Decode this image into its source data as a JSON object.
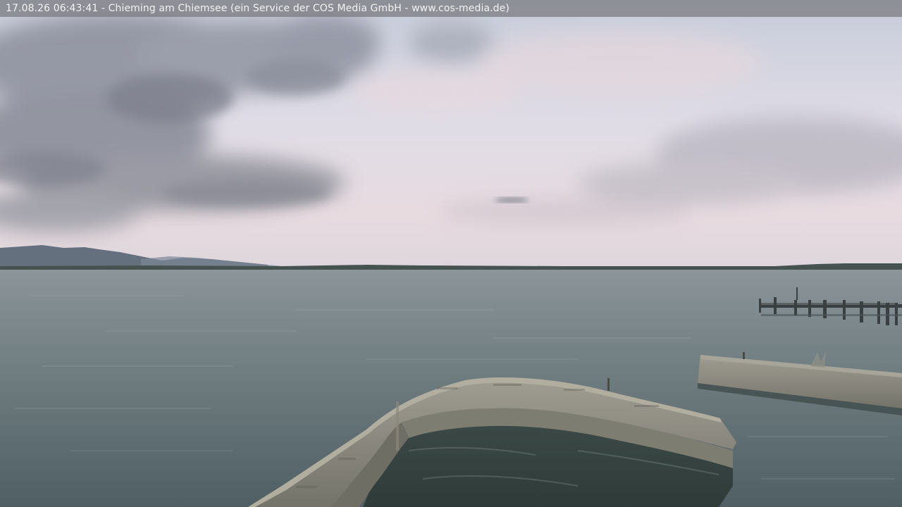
{
  "overlay": {
    "caption": "17.08.26 06:43:41 - Chieming am Chiemsee (ein Service der COS Media GmbH - www.cos-media.de)"
  },
  "scene": {
    "subject": "lake-chiemsee-morning-webcam",
    "palette": {
      "sky_top": "#c9d0de",
      "sky_horizon": "#e6dadf",
      "cloud_dark": "#7a7e8a",
      "mountains": "#5f6b78",
      "shoreline": "#3f4a4d",
      "water_far": "#7f8a8e",
      "water_near": "#56656a",
      "stone": "#8c8a80",
      "pier": "#3a3e40"
    }
  }
}
